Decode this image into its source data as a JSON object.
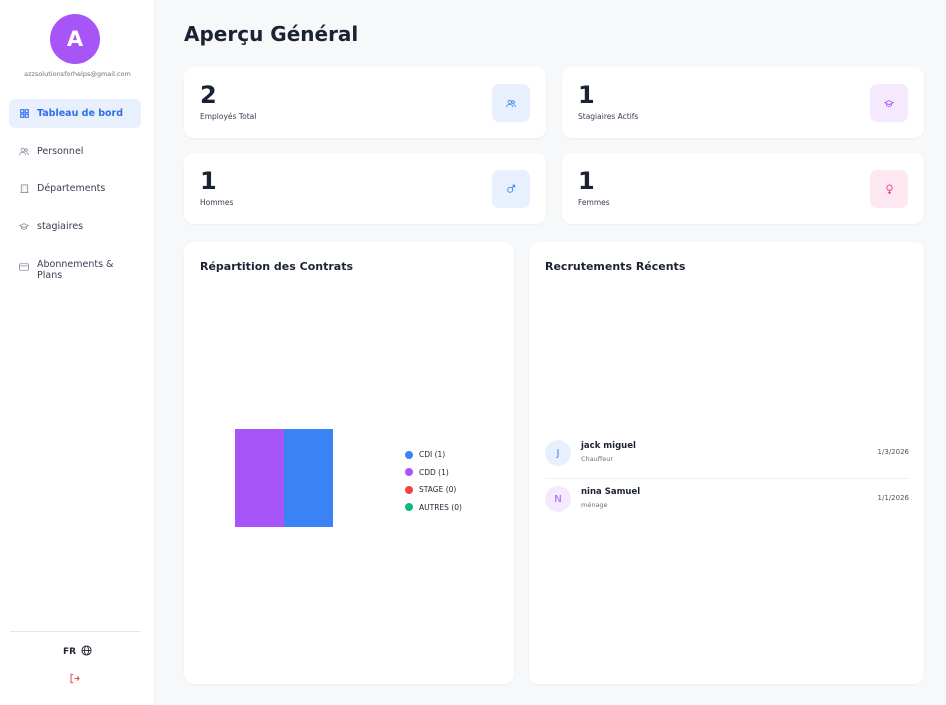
{
  "sidebar": {
    "avatar_letter": "A",
    "email": "azzsolutionsforhelps@gmail.com",
    "items": [
      {
        "label": "Tableau de bord",
        "icon": "grid-icon",
        "active": true
      },
      {
        "label": "Personnel",
        "icon": "users-icon"
      },
      {
        "label": "Départements",
        "icon": "building-icon"
      },
      {
        "label": "stagiaires",
        "icon": "graduation-cap-icon"
      },
      {
        "label": "Abonnements & Plans",
        "icon": "credit-card-icon"
      }
    ],
    "language": "FR",
    "language_icon": "globe-icon",
    "logout_icon": "logout-icon"
  },
  "page": {
    "title": "Aperçu Général"
  },
  "stats": [
    {
      "value": "2",
      "label": "Employés Total",
      "icon": "users-icon",
      "icon_bg": "#e8f0fd",
      "icon_color": "#3b82f6"
    },
    {
      "value": "1",
      "label": "Stagiaires Actifs",
      "icon": "graduation-cap-icon",
      "icon_bg": "#f5e9fe",
      "icon_color": "#a855f7"
    },
    {
      "value": "1",
      "label": "Hommes",
      "icon": "male-icon",
      "icon_bg": "#e8f0fd",
      "icon_color": "#3b82f6"
    },
    {
      "value": "1",
      "label": "Femmes",
      "icon": "female-icon",
      "icon_bg": "#fde8f1",
      "icon_color": "#ec4899"
    }
  ],
  "contracts": {
    "title": "Répartition des Contrats",
    "legend": [
      {
        "label": "CDI (1)",
        "color": "#3b82f6"
      },
      {
        "label": "CDD (1)",
        "color": "#a855f7"
      },
      {
        "label": "STAGE (0)",
        "color": "#ef4444"
      },
      {
        "label": "AUTRES (0)",
        "color": "#10b981"
      }
    ]
  },
  "chart_data": {
    "type": "pie",
    "labels": [
      "CDI",
      "CDD",
      "STAGE",
      "AUTRES"
    ],
    "values": [
      1,
      1,
      0,
      0
    ],
    "colors": [
      "#3b82f6",
      "#a855f7",
      "#ef4444",
      "#10b981"
    ],
    "legend": "right"
  },
  "recruitments": {
    "title": "Recrutements Récents",
    "items": [
      {
        "initial": "J",
        "name": "jack miguel",
        "role": "Chauffeur",
        "date": "1/3/2026",
        "avatar_bg": "#e8f0fd",
        "avatar_color": "#3b82f6"
      },
      {
        "initial": "N",
        "name": "nina Samuel",
        "role": "ménage",
        "date": "1/1/2026",
        "avatar_bg": "#f5e9fe",
        "avatar_color": "#a855f7"
      }
    ]
  }
}
